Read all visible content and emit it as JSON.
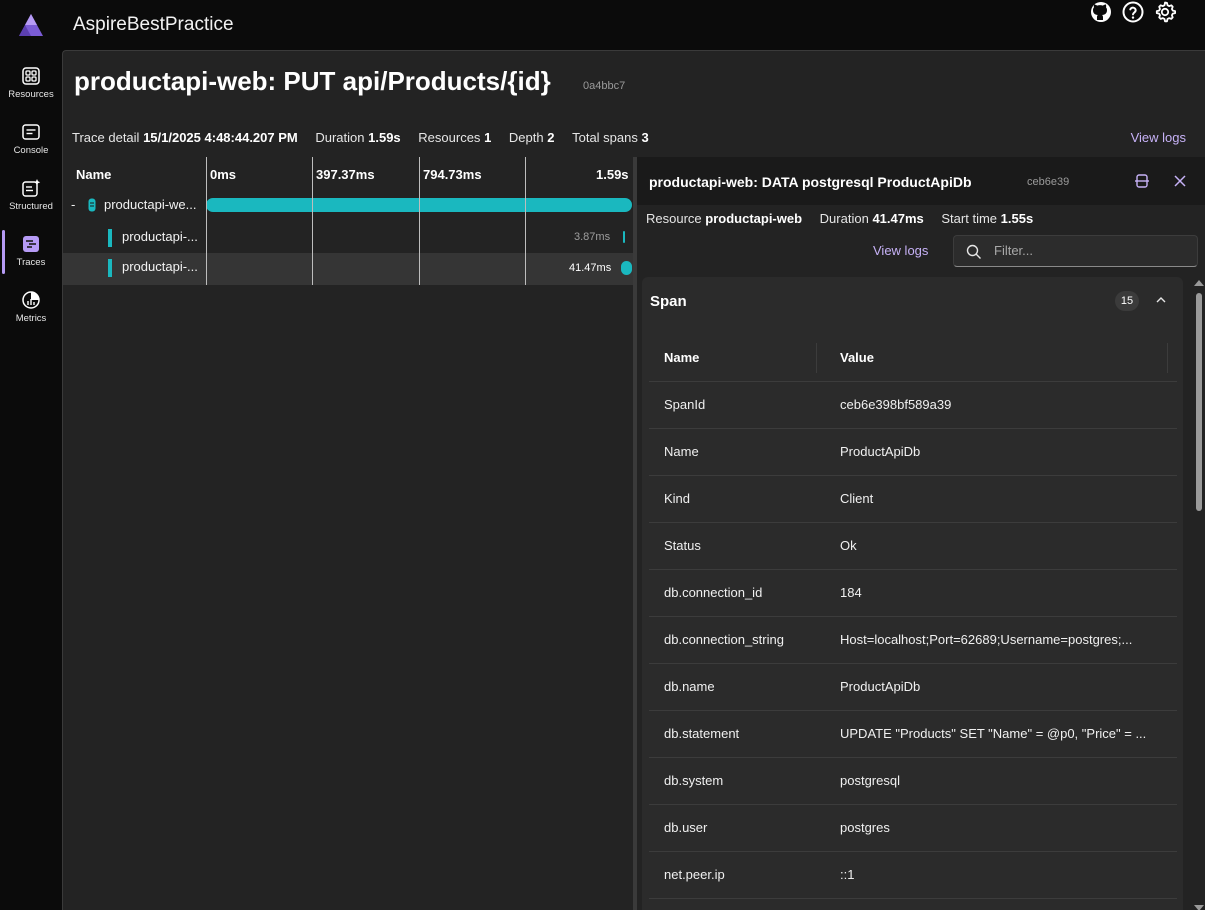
{
  "app": {
    "title": "AspireBestPractice"
  },
  "topbar": {
    "icons": [
      "github-icon",
      "help-icon",
      "settings-icon"
    ]
  },
  "nav": {
    "items": [
      {
        "label": "Resources",
        "icon": "resources-icon",
        "active": false
      },
      {
        "label": "Console",
        "icon": "console-icon",
        "active": false
      },
      {
        "label": "Structured",
        "icon": "structured-icon",
        "active": false
      },
      {
        "label": "Traces",
        "icon": "traces-icon",
        "active": true
      },
      {
        "label": "Metrics",
        "icon": "metrics-icon",
        "active": false
      }
    ]
  },
  "page": {
    "title": "productapi-web: PUT api/Products/{id}",
    "trace_id": "0a4bbc7",
    "summary": {
      "trace_detail_label": "Trace detail",
      "trace_detail_value": "15/1/2025 4:48:44.207 PM",
      "duration_label": "Duration",
      "duration_value": "1.59s",
      "resources_label": "Resources",
      "resources_value": "1",
      "depth_label": "Depth",
      "depth_value": "2",
      "total_spans_label": "Total spans",
      "total_spans_value": "3"
    },
    "view_logs": "View logs"
  },
  "grid": {
    "name_header": "Name",
    "ticks": [
      "0ms",
      "397.37ms",
      "794.73ms",
      "1.59s"
    ],
    "collapse_symbol": "-",
    "rows": [
      {
        "label": "productapi-we...",
        "start_fraction": 0.0,
        "end_fraction": 1.0,
        "duration": "",
        "selected": false
      },
      {
        "label": "productapi-...",
        "start_fraction": 0.978,
        "end_fraction": 0.981,
        "duration": "3.87ms",
        "selected": false
      },
      {
        "label": "productapi-...",
        "start_fraction": 0.974,
        "end_fraction": 1.0,
        "duration": "41.47ms",
        "selected": true
      }
    ]
  },
  "detail": {
    "title": "productapi-web: DATA postgresql ProductApiDb",
    "span_id_short": "ceb6e39",
    "resource_label": "Resource",
    "resource_value": "productapi-web",
    "duration_label": "Duration",
    "duration_value": "41.47ms",
    "start_label": "Start time",
    "start_value": "1.55s",
    "view_logs": "View logs",
    "filter_placeholder": "Filter...",
    "section_title": "Span",
    "section_count": "15",
    "col_name": "Name",
    "col_value": "Value",
    "properties": [
      {
        "name": "SpanId",
        "value": "ceb6e398bf589a39"
      },
      {
        "name": "Name",
        "value": "ProductApiDb"
      },
      {
        "name": "Kind",
        "value": "Client"
      },
      {
        "name": "Status",
        "value": "Ok"
      },
      {
        "name": "db.connection_id",
        "value": "184"
      },
      {
        "name": "db.connection_string",
        "value": "Host=localhost;Port=62689;Username=postgres;..."
      },
      {
        "name": "db.name",
        "value": "ProductApiDb"
      },
      {
        "name": "db.statement",
        "value": "UPDATE \"Products\" SET \"Name\" = @p0, \"Price\" = ..."
      },
      {
        "name": "db.system",
        "value": "postgresql"
      },
      {
        "name": "db.user",
        "value": "postgres"
      },
      {
        "name": "net.peer.ip",
        "value": "::1"
      }
    ]
  },
  "colors": {
    "accent": "#b69bf5",
    "link": "#c7b2f7",
    "span_bar": "#1ab8bf"
  }
}
